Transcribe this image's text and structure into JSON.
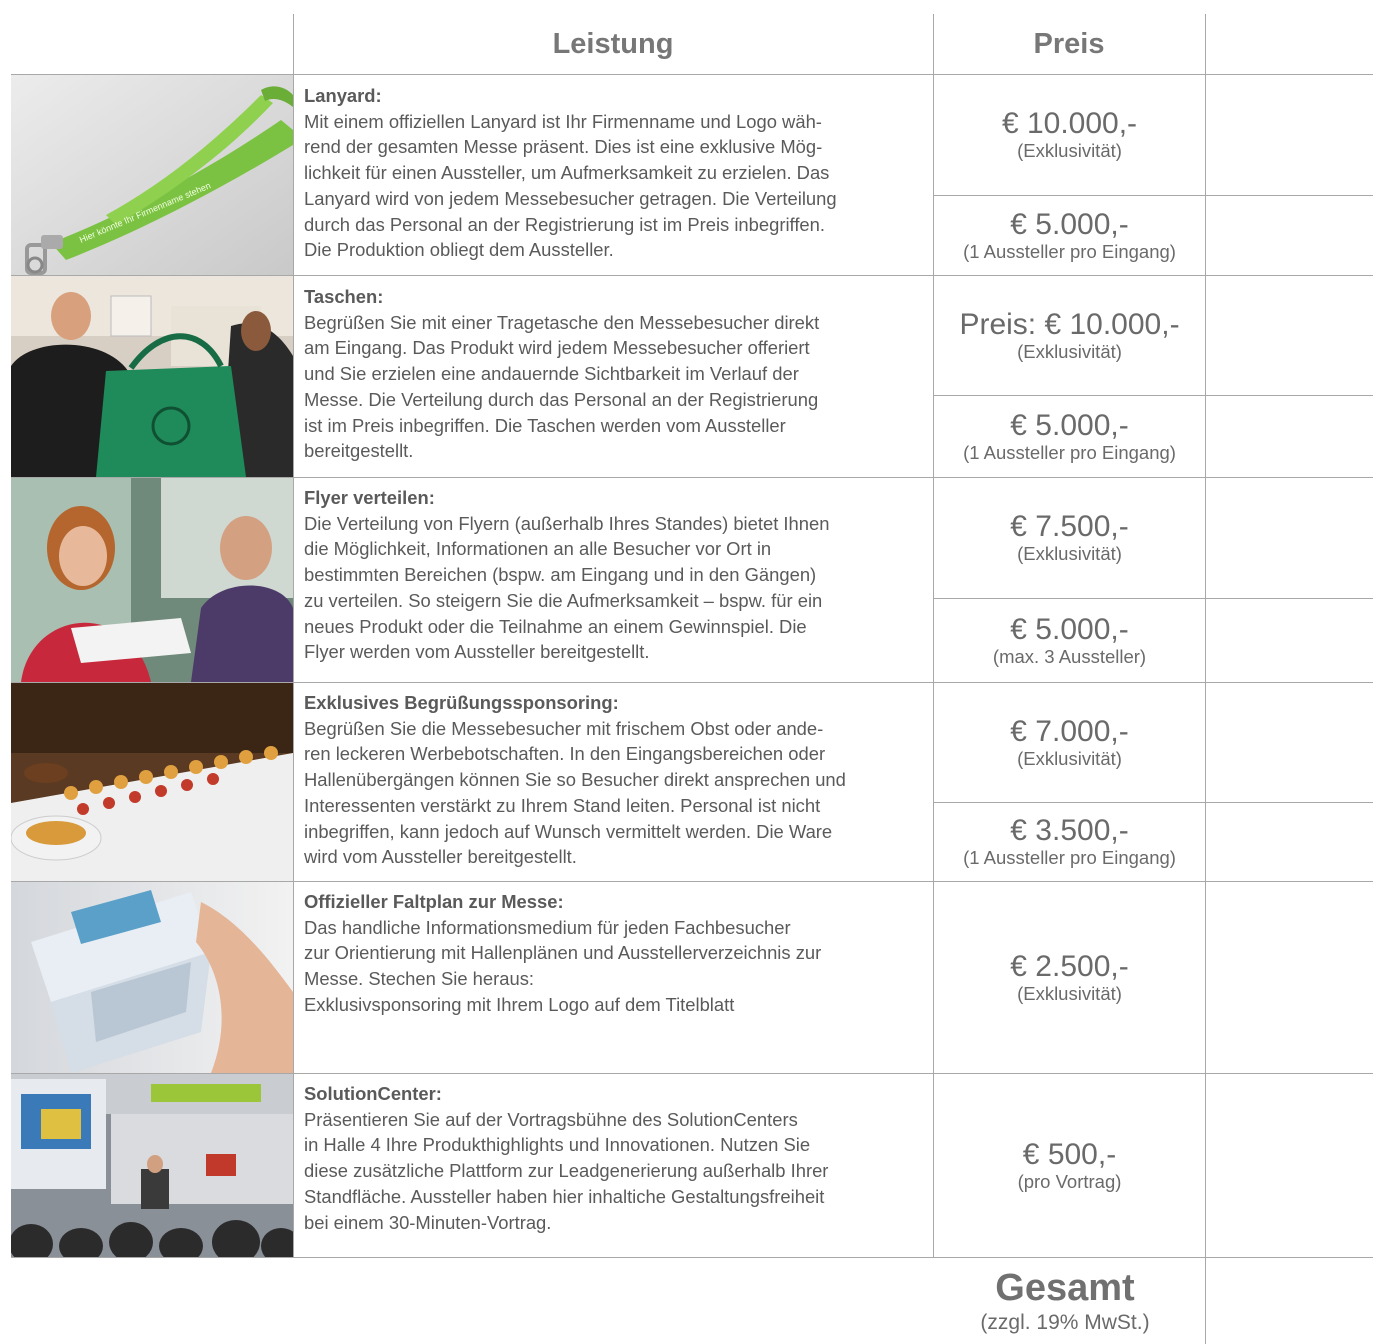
{
  "header": {
    "leistung": "Leistung",
    "preis": "Preis"
  },
  "rows": [
    {
      "title": "Lanyard:",
      "body": "Mit einem offiziellen Lanyard ist Ihr Firmenname und Logo wäh-\nrend der gesamten Messe präsent. Dies ist eine exklusive Mög-\nlichkeit für einen Aussteller, um Aufmerksamkeit zu erzielen. Das\nLanyard wird von jedem Messebesucher getragen. Die Verteilung\ndurch das Personal an der Registrierung ist im Preis inbegriffen.\nDie Produktion obliegt dem Aussteller.",
      "image_text": "Hier könnte Ihr Firmenname stehen",
      "prices": [
        {
          "price": "€ 10.000,-",
          "note": "(Exklusivität)"
        },
        {
          "price": "€ 5.000,-",
          "note": "(1 Aussteller pro Eingang)"
        }
      ]
    },
    {
      "title": "Taschen:",
      "body": "Begrüßen Sie mit einer Tragetasche den Messebesucher direkt\nam Eingang. Das Produkt wird jedem Messebesucher offeriert\nund Sie erzielen eine andauernde Sichtbarkeit im Verlauf der\nMesse. Die Verteilung durch das Personal an der Registrierung\nist im Preis inbegriffen. Die Taschen werden vom Aussteller\nbereitgestellt.",
      "prices": [
        {
          "price": "Preis: € 10.000,-",
          "note": "(Exklusivität)"
        },
        {
          "price": "€ 5.000,-",
          "note": "(1 Aussteller pro Eingang)"
        }
      ]
    },
    {
      "title": "Flyer verteilen:",
      "body": "Die Verteilung von Flyern (außerhalb Ihres Standes) bietet Ihnen\ndie Möglichkeit, Informationen an alle Besucher vor Ort in\nbestimmten  Bereichen (bspw. am Eingang und in den Gängen)\nzu verteilen. So steigern Sie die Aufmerksamkeit – bspw. für ein\nneues Produkt oder die Teilnahme an einem Gewinnspiel. Die\nFlyer werden vom Aussteller bereitgestellt.",
      "prices": [
        {
          "price": "€ 7.500,-",
          "note": "(Exklusivität)"
        },
        {
          "price": "€ 5.000,-",
          "note": "(max. 3 Aussteller)"
        }
      ]
    },
    {
      "title": "Exklusives Begrüßungssponsoring:",
      "body": "Begrüßen Sie die Messebesucher mit frischem Obst oder ande-\nren leckeren Werbebotschaften. In den Eingangsbereichen oder\nHallenübergängen können Sie so Besucher direkt ansprechen und\nInteressenten verstärkt zu Ihrem Stand leiten. Personal ist nicht\ninbegriffen, kann jedoch auf Wunsch vermittelt werden. Die Ware\nwird vom Aussteller bereitgestellt.",
      "prices": [
        {
          "price": "€ 7.000,-",
          "note": "(Exklusivität)"
        },
        {
          "price": "€ 3.500,-",
          "note": "(1 Aussteller pro Eingang)"
        }
      ]
    },
    {
      "title": "Offizieller Faltplan zur Messe:",
      "body": "Das handliche Informationsmedium für jeden Fachbesucher\nzur Orientierung mit Hallenplänen und Ausstellerverzeichnis zur\nMesse. Stechen Sie heraus:\nExklusivsponsoring mit Ihrem Logo auf dem Titelblatt",
      "prices": [
        {
          "price": "€ 2.500,-",
          "note": "(Exklusivität)"
        }
      ]
    },
    {
      "title": "SolutionCenter:",
      "body": "Präsentieren Sie auf der Vortragsbühne des SolutionCenters\nin Halle 4 Ihre Produkthighlights und Innovationen. Nutzen Sie\ndiese zusätzliche Plattform zur Leadgenerierung außerhalb Ihrer\nStandfläche. Aussteller haben hier inhaltiche Gestaltungsfreiheit\nbei einem 30-Minuten-Vortrag.",
      "prices": [
        {
          "price": "€ 500,-",
          "note": "(pro Vortrag)"
        }
      ]
    }
  ],
  "total": {
    "label": "Gesamt",
    "note": "(zzgl. 19% MwSt.)"
  },
  "colors": {
    "rule": "#a8a8a8",
    "text": "#5a5a5a",
    "lanyard_green": "#7cc242",
    "bag_green": "#1f8a5a"
  }
}
